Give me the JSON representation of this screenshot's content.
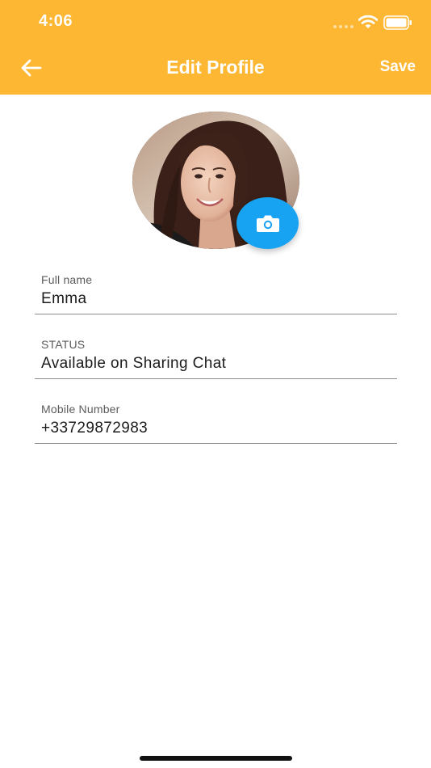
{
  "status_bar": {
    "time": "4:06",
    "icons": [
      "signal-icon",
      "wifi-icon",
      "battery-icon"
    ]
  },
  "header": {
    "title": "Edit Profile",
    "save_label": "Save",
    "back_icon": "arrow-left-icon",
    "background_color": "#FDB732"
  },
  "profile": {
    "camera_icon": "camera-icon",
    "camera_button_color": "#18A3F2"
  },
  "fields": {
    "full_name": {
      "label": "Full name",
      "value": "Emma"
    },
    "status": {
      "label": "STATUS",
      "value": "Available on Sharing Chat"
    },
    "mobile": {
      "label": "Mobile Number",
      "value": "+33729872983"
    }
  }
}
